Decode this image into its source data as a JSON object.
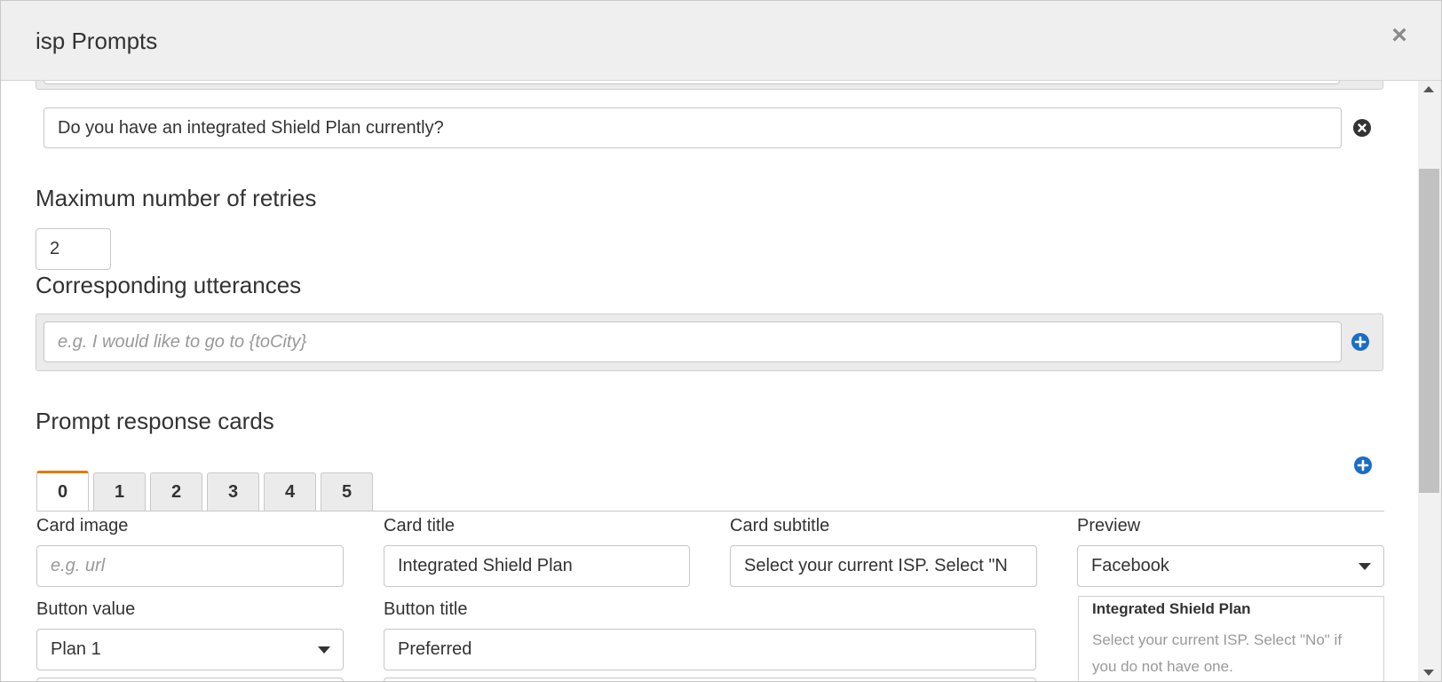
{
  "modal": {
    "title": "isp Prompts",
    "close_glyph": "×"
  },
  "prompts": {
    "existing_prompt_value": "Do you have an integrated Shield Plan currently?"
  },
  "retries": {
    "heading": "Maximum number of retries",
    "value": "2"
  },
  "utterances": {
    "heading": "Corresponding utterances",
    "placeholder": "e.g. I would like to go to {toCity}"
  },
  "cards": {
    "heading": "Prompt response cards",
    "tabs": [
      "0",
      "1",
      "2",
      "3",
      "4",
      "5"
    ],
    "active_tab": "0",
    "card_image_label": "Card image",
    "card_image_placeholder": "e.g. url",
    "card_title_label": "Card title",
    "card_title_value": "Integrated Shield Plan",
    "card_subtitle_label": "Card subtitle",
    "card_subtitle_value": "Select your current ISP. Select \"N",
    "preview_label": "Preview",
    "preview_value": "Facebook",
    "button_value_label": "Button value",
    "button_value_selected": "Plan 1",
    "button_title_label": "Button title",
    "button_title_value": "Preferred",
    "preview_card": {
      "title": "Integrated Shield Plan",
      "subtitle": "Select your current ISP. Select \"No\" if you do not have one."
    }
  },
  "icons": {
    "remove": "remove-circle-icon",
    "add": "add-circle-icon",
    "close": "close-icon"
  },
  "colors": {
    "accent_blue": "#1a6dc4",
    "tab_active_orange": "#e07b00",
    "remove_icon": "#333333"
  }
}
